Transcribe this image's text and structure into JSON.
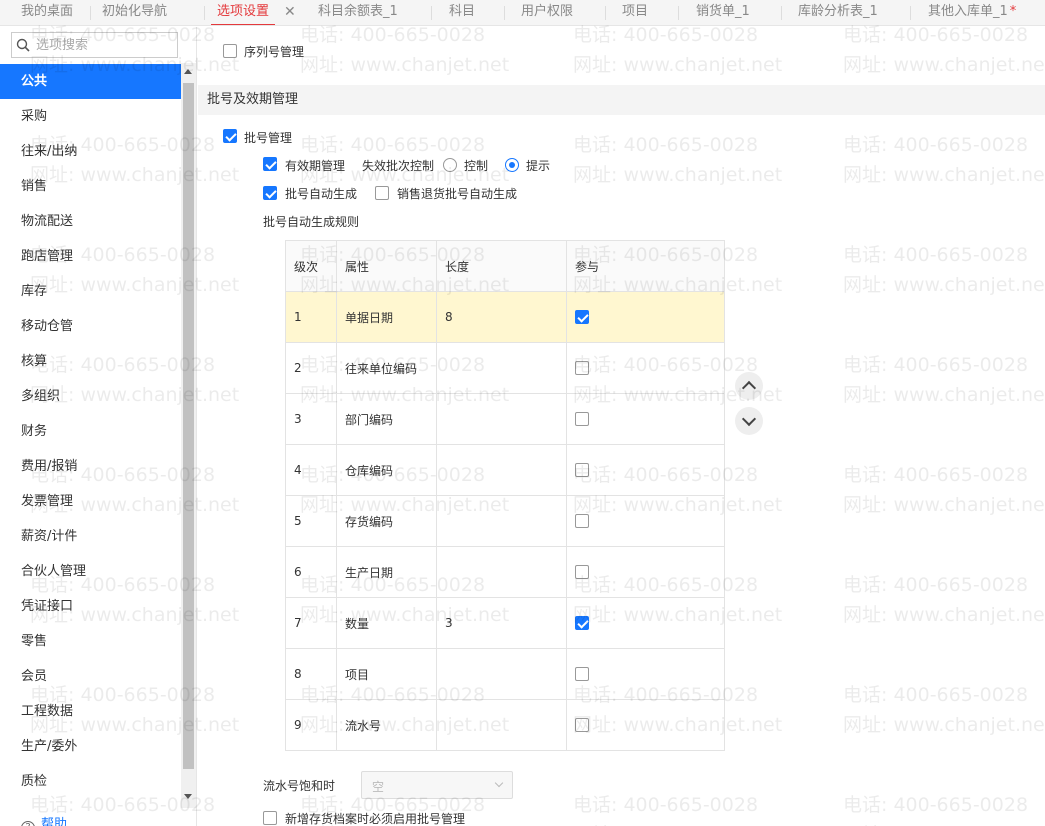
{
  "tabs": [
    {
      "label": "我的桌面"
    },
    {
      "label": "初始化导航"
    },
    {
      "label": "选项设置",
      "active": true,
      "close": "✕"
    },
    {
      "label": "科目余额表_1"
    },
    {
      "label": "科目"
    },
    {
      "label": "用户权限"
    },
    {
      "label": "项目"
    },
    {
      "label": "销货单_1"
    },
    {
      "label": "库龄分析表_1"
    },
    {
      "label": "其他入库单_1",
      "mark": "*"
    }
  ],
  "sidebar": {
    "search_placeholder": "选项搜索",
    "items": [
      "公共",
      "采购",
      "往来/出纳",
      "销售",
      "物流配送",
      "跑店管理",
      "库存",
      "移动仓管",
      "核算",
      "多组织",
      "财务",
      "费用/报销",
      "发票管理",
      "薪资/计件",
      "合伙人管理",
      "凭证接口",
      "零售",
      "会员",
      "工程数据",
      "生产/委外",
      "质检"
    ],
    "active_index": 0,
    "help_label": "帮助"
  },
  "main": {
    "serial_mgmt": {
      "label": "序列号管理",
      "checked": false
    },
    "section_title": "批号及效期管理",
    "batch_mgmt": {
      "label": "批号管理",
      "checked": true
    },
    "validity_mgmt": {
      "label": "有效期管理",
      "checked": true
    },
    "expired_control_label": "失效批次控制",
    "radio_control": {
      "label": "控制",
      "checked": false
    },
    "radio_prompt": {
      "label": "提示",
      "checked": true
    },
    "auto_batch": {
      "label": "批号自动生成",
      "checked": true
    },
    "return_auto_batch": {
      "label": "销售退货批号自动生成",
      "checked": false
    },
    "rule_title": "批号自动生成规则",
    "table": {
      "headers": [
        "级次",
        "属性",
        "长度",
        "参与"
      ],
      "rows": [
        {
          "level": "1",
          "attr": "单据日期",
          "length": "8",
          "join": true
        },
        {
          "level": "2",
          "attr": "往来单位编码",
          "length": "",
          "join": false
        },
        {
          "level": "3",
          "attr": "部门编码",
          "length": "",
          "join": false
        },
        {
          "level": "4",
          "attr": "仓库编码",
          "length": "",
          "join": false
        },
        {
          "level": "5",
          "attr": "存货编码",
          "length": "",
          "join": false
        },
        {
          "level": "6",
          "attr": "生产日期",
          "length": "",
          "join": false
        },
        {
          "level": "7",
          "attr": "数量",
          "length": "3",
          "join": true
        },
        {
          "level": "8",
          "attr": "项目",
          "length": "",
          "join": false
        },
        {
          "level": "9",
          "attr": "流水号",
          "length": "",
          "join": false
        }
      ],
      "selected_row": 0
    },
    "serial_saturation_label": "流水号饱和时",
    "serial_saturation_value": "空",
    "new_inventory_batch": {
      "label": "新增存货档案时必须启用批号管理",
      "checked": false
    }
  },
  "watermark": {
    "phone": "电话: 400-665-0028",
    "site": "网址: www.chanjet.net"
  },
  "colors": {
    "accent": "#1677ff",
    "active_tab": "#e4393c",
    "selected_row": "#fff7d0"
  }
}
